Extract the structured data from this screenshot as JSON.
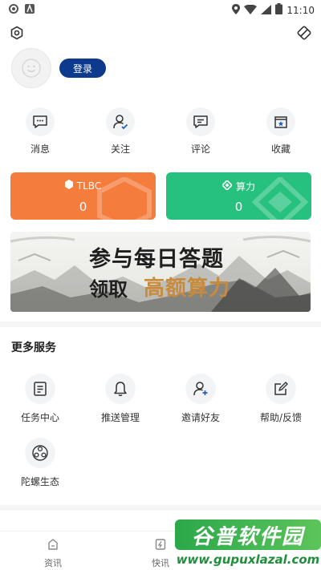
{
  "status_bar": {
    "time": "11:10"
  },
  "profile": {
    "login_label": "登录"
  },
  "quick_actions": [
    {
      "label": "消息",
      "icon": "message-icon"
    },
    {
      "label": "关注",
      "icon": "follow-user-icon"
    },
    {
      "label": "评论",
      "icon": "comment-icon"
    },
    {
      "label": "收藏",
      "icon": "favorite-icon"
    }
  ],
  "cards": {
    "tlbc": {
      "label": "TLBC",
      "value": "0",
      "color": "#f47c3c"
    },
    "hashrate": {
      "label": "算力",
      "value": "0",
      "color": "#26c17e"
    }
  },
  "banner": {
    "line1": "参与每日答题",
    "line2a": "领取",
    "line2b": "高额算力"
  },
  "more_services": {
    "title": "更多服务",
    "items": [
      {
        "label": "任务中心",
        "icon": "task-icon"
      },
      {
        "label": "推送管理",
        "icon": "bell-icon"
      },
      {
        "label": "邀请好友",
        "icon": "invite-user-icon"
      },
      {
        "label": "帮助/反馈",
        "icon": "feedback-icon"
      },
      {
        "label": "陀螺生态",
        "icon": "ecosystem-icon"
      }
    ]
  },
  "bottom_nav": [
    {
      "label": "资讯",
      "icon": "news-icon"
    },
    {
      "label": "快讯",
      "icon": "flash-news-icon"
    }
  ],
  "watermark": {
    "title": "谷普软件园",
    "url": "www.gupuxlazal.com"
  },
  "colors": {
    "accent_blue": "#0d3a8c",
    "orange": "#f47c3c",
    "green": "#26c17e"
  }
}
